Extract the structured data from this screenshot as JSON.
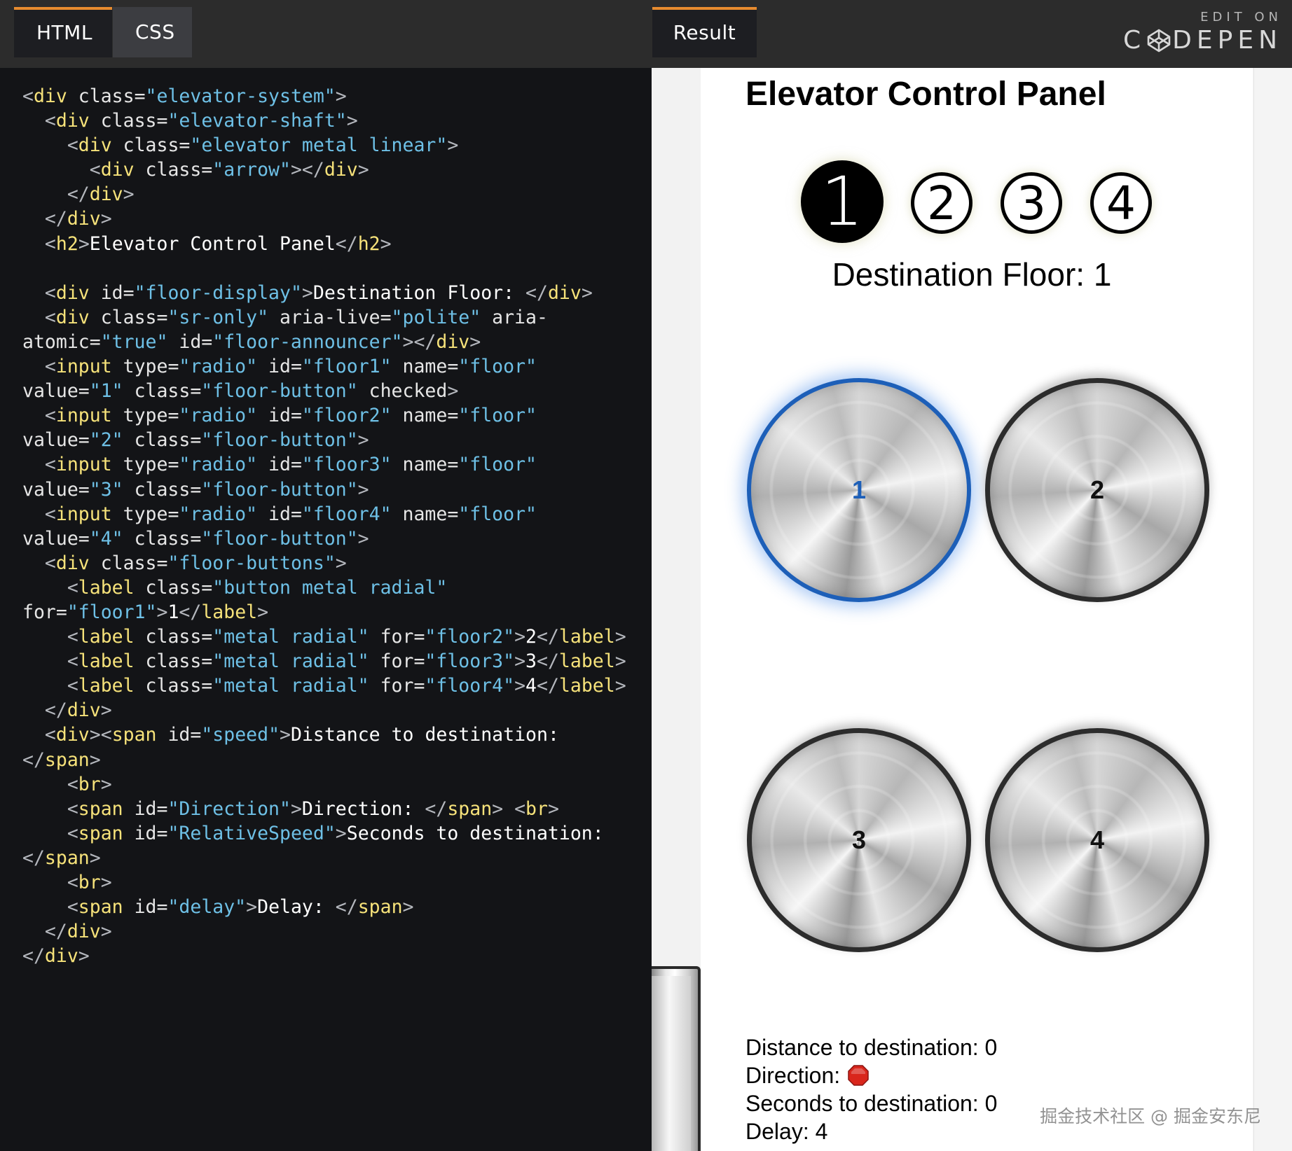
{
  "editor": {
    "tabs": [
      {
        "label": "HTML",
        "active": true
      },
      {
        "label": "CSS",
        "active": false
      }
    ],
    "code_lines": [
      [
        [
          "pn",
          "<"
        ],
        [
          "tg",
          "div"
        ],
        [
          "at",
          " class="
        ],
        [
          "st",
          "\"elevator-system\""
        ],
        [
          "pn",
          ">"
        ]
      ],
      [
        [
          "tx",
          "  "
        ],
        [
          "pn",
          "<"
        ],
        [
          "tg",
          "div"
        ],
        [
          "at",
          " class="
        ],
        [
          "st",
          "\"elevator-shaft\""
        ],
        [
          "pn",
          ">"
        ]
      ],
      [
        [
          "tx",
          "    "
        ],
        [
          "pn",
          "<"
        ],
        [
          "tg",
          "div"
        ],
        [
          "at",
          " class="
        ],
        [
          "st",
          "\"elevator metal linear\""
        ],
        [
          "pn",
          ">"
        ]
      ],
      [
        [
          "tx",
          "      "
        ],
        [
          "pn",
          "<"
        ],
        [
          "tg",
          "div"
        ],
        [
          "at",
          " class="
        ],
        [
          "st",
          "\"arrow\""
        ],
        [
          "pn",
          "></"
        ],
        [
          "tg",
          "div"
        ],
        [
          "pn",
          ">"
        ]
      ],
      [
        [
          "tx",
          "    "
        ],
        [
          "pn",
          "</"
        ],
        [
          "tg",
          "div"
        ],
        [
          "pn",
          ">"
        ]
      ],
      [
        [
          "tx",
          "  "
        ],
        [
          "pn",
          "</"
        ],
        [
          "tg",
          "div"
        ],
        [
          "pn",
          ">"
        ]
      ],
      [
        [
          "tx",
          "  "
        ],
        [
          "pn",
          "<"
        ],
        [
          "tg",
          "h2"
        ],
        [
          "pn",
          ">"
        ],
        [
          "tx",
          "Elevator Control Panel"
        ],
        [
          "pn",
          "</"
        ],
        [
          "tg",
          "h2"
        ],
        [
          "pn",
          ">"
        ]
      ],
      [
        [
          "tx",
          ""
        ]
      ],
      [
        [
          "tx",
          "  "
        ],
        [
          "pn",
          "<"
        ],
        [
          "tg",
          "div"
        ],
        [
          "at",
          " id="
        ],
        [
          "st",
          "\"floor-display\""
        ],
        [
          "pn",
          ">"
        ],
        [
          "tx",
          "Destination Floor: "
        ],
        [
          "pn",
          "</"
        ],
        [
          "tg",
          "div"
        ],
        [
          "pn",
          ">"
        ]
      ],
      [
        [
          "tx",
          "  "
        ],
        [
          "pn",
          "<"
        ],
        [
          "tg",
          "div"
        ],
        [
          "at",
          " class="
        ],
        [
          "st",
          "\"sr-only\""
        ],
        [
          "at",
          " aria-live="
        ],
        [
          "st",
          "\"polite\""
        ],
        [
          "at",
          " aria-"
        ]
      ],
      [
        [
          "at",
          "atomic="
        ],
        [
          "st",
          "\"true\""
        ],
        [
          "at",
          " id="
        ],
        [
          "st",
          "\"floor-announcer\""
        ],
        [
          "pn",
          "></"
        ],
        [
          "tg",
          "div"
        ],
        [
          "pn",
          ">"
        ]
      ],
      [
        [
          "tx",
          "  "
        ],
        [
          "pn",
          "<"
        ],
        [
          "tg",
          "input"
        ],
        [
          "at",
          " type="
        ],
        [
          "st",
          "\"radio\""
        ],
        [
          "at",
          " id="
        ],
        [
          "st",
          "\"floor1\""
        ],
        [
          "at",
          " name="
        ],
        [
          "st",
          "\"floor\""
        ]
      ],
      [
        [
          "at",
          "value="
        ],
        [
          "st",
          "\"1\""
        ],
        [
          "at",
          " class="
        ],
        [
          "st",
          "\"floor-button\""
        ],
        [
          "at",
          " checked"
        ],
        [
          "pn",
          ">"
        ]
      ],
      [
        [
          "tx",
          "  "
        ],
        [
          "pn",
          "<"
        ],
        [
          "tg",
          "input"
        ],
        [
          "at",
          " type="
        ],
        [
          "st",
          "\"radio\""
        ],
        [
          "at",
          " id="
        ],
        [
          "st",
          "\"floor2\""
        ],
        [
          "at",
          " name="
        ],
        [
          "st",
          "\"floor\""
        ]
      ],
      [
        [
          "at",
          "value="
        ],
        [
          "st",
          "\"2\""
        ],
        [
          "at",
          " class="
        ],
        [
          "st",
          "\"floor-button\""
        ],
        [
          "pn",
          ">"
        ]
      ],
      [
        [
          "tx",
          "  "
        ],
        [
          "pn",
          "<"
        ],
        [
          "tg",
          "input"
        ],
        [
          "at",
          " type="
        ],
        [
          "st",
          "\"radio\""
        ],
        [
          "at",
          " id="
        ],
        [
          "st",
          "\"floor3\""
        ],
        [
          "at",
          " name="
        ],
        [
          "st",
          "\"floor\""
        ]
      ],
      [
        [
          "at",
          "value="
        ],
        [
          "st",
          "\"3\""
        ],
        [
          "at",
          " class="
        ],
        [
          "st",
          "\"floor-button\""
        ],
        [
          "pn",
          ">"
        ]
      ],
      [
        [
          "tx",
          "  "
        ],
        [
          "pn",
          "<"
        ],
        [
          "tg",
          "input"
        ],
        [
          "at",
          " type="
        ],
        [
          "st",
          "\"radio\""
        ],
        [
          "at",
          " id="
        ],
        [
          "st",
          "\"floor4\""
        ],
        [
          "at",
          " name="
        ],
        [
          "st",
          "\"floor\""
        ]
      ],
      [
        [
          "at",
          "value="
        ],
        [
          "st",
          "\"4\""
        ],
        [
          "at",
          " class="
        ],
        [
          "st",
          "\"floor-button\""
        ],
        [
          "pn",
          ">"
        ]
      ],
      [
        [
          "tx",
          "  "
        ],
        [
          "pn",
          "<"
        ],
        [
          "tg",
          "div"
        ],
        [
          "at",
          " class="
        ],
        [
          "st",
          "\"floor-buttons\""
        ],
        [
          "pn",
          ">"
        ]
      ],
      [
        [
          "tx",
          "    "
        ],
        [
          "pn",
          "<"
        ],
        [
          "tg",
          "label"
        ],
        [
          "at",
          " class="
        ],
        [
          "st",
          "\"button metal radial\""
        ]
      ],
      [
        [
          "at",
          "for="
        ],
        [
          "st",
          "\"floor1\""
        ],
        [
          "pn",
          ">"
        ],
        [
          "tx",
          "1"
        ],
        [
          "pn",
          "</"
        ],
        [
          "tg",
          "label"
        ],
        [
          "pn",
          ">"
        ]
      ],
      [
        [
          "tx",
          "    "
        ],
        [
          "pn",
          "<"
        ],
        [
          "tg",
          "label"
        ],
        [
          "at",
          " class="
        ],
        [
          "st",
          "\"metal radial\""
        ],
        [
          "at",
          " for="
        ],
        [
          "st",
          "\"floor2\""
        ],
        [
          "pn",
          ">"
        ],
        [
          "tx",
          "2"
        ],
        [
          "pn",
          "</"
        ],
        [
          "tg",
          "label"
        ],
        [
          "pn",
          ">"
        ]
      ],
      [
        [
          "tx",
          "    "
        ],
        [
          "pn",
          "<"
        ],
        [
          "tg",
          "label"
        ],
        [
          "at",
          " class="
        ],
        [
          "st",
          "\"metal radial\""
        ],
        [
          "at",
          " for="
        ],
        [
          "st",
          "\"floor3\""
        ],
        [
          "pn",
          ">"
        ],
        [
          "tx",
          "3"
        ],
        [
          "pn",
          "</"
        ],
        [
          "tg",
          "label"
        ],
        [
          "pn",
          ">"
        ]
      ],
      [
        [
          "tx",
          "    "
        ],
        [
          "pn",
          "<"
        ],
        [
          "tg",
          "label"
        ],
        [
          "at",
          " class="
        ],
        [
          "st",
          "\"metal radial\""
        ],
        [
          "at",
          " for="
        ],
        [
          "st",
          "\"floor4\""
        ],
        [
          "pn",
          ">"
        ],
        [
          "tx",
          "4"
        ],
        [
          "pn",
          "</"
        ],
        [
          "tg",
          "label"
        ],
        [
          "pn",
          ">"
        ]
      ],
      [
        [
          "tx",
          "  "
        ],
        [
          "pn",
          "</"
        ],
        [
          "tg",
          "div"
        ],
        [
          "pn",
          ">"
        ]
      ],
      [
        [
          "tx",
          "  "
        ],
        [
          "pn",
          "<"
        ],
        [
          "tg",
          "div"
        ],
        [
          "pn",
          "><"
        ],
        [
          "tg",
          "span"
        ],
        [
          "at",
          " id="
        ],
        [
          "st",
          "\"speed\""
        ],
        [
          "pn",
          ">"
        ],
        [
          "tx",
          "Distance to destination:"
        ]
      ],
      [
        [
          "pn",
          "</"
        ],
        [
          "tg",
          "span"
        ],
        [
          "pn",
          ">"
        ]
      ],
      [
        [
          "tx",
          "    "
        ],
        [
          "pn",
          "<"
        ],
        [
          "tg",
          "br"
        ],
        [
          "pn",
          ">"
        ]
      ],
      [
        [
          "tx",
          "    "
        ],
        [
          "pn",
          "<"
        ],
        [
          "tg",
          "span"
        ],
        [
          "at",
          " id="
        ],
        [
          "st",
          "\"Direction\""
        ],
        [
          "pn",
          ">"
        ],
        [
          "tx",
          "Direction: "
        ],
        [
          "pn",
          "</"
        ],
        [
          "tg",
          "span"
        ],
        [
          "pn",
          "> <"
        ],
        [
          "tg",
          "br"
        ],
        [
          "pn",
          ">"
        ]
      ],
      [
        [
          "tx",
          "    "
        ],
        [
          "pn",
          "<"
        ],
        [
          "tg",
          "span"
        ],
        [
          "at",
          " id="
        ],
        [
          "st",
          "\"RelativeSpeed\""
        ],
        [
          "pn",
          ">"
        ],
        [
          "tx",
          "Seconds to destination:"
        ]
      ],
      [
        [
          "pn",
          "</"
        ],
        [
          "tg",
          "span"
        ],
        [
          "pn",
          ">"
        ]
      ],
      [
        [
          "tx",
          "    "
        ],
        [
          "pn",
          "<"
        ],
        [
          "tg",
          "br"
        ],
        [
          "pn",
          ">"
        ]
      ],
      [
        [
          "tx",
          "    "
        ],
        [
          "pn",
          "<"
        ],
        [
          "tg",
          "span"
        ],
        [
          "at",
          " id="
        ],
        [
          "st",
          "\"delay\""
        ],
        [
          "pn",
          ">"
        ],
        [
          "tx",
          "Delay: "
        ],
        [
          "pn",
          "</"
        ],
        [
          "tg",
          "span"
        ],
        [
          "pn",
          ">"
        ]
      ],
      [
        [
          "tx",
          "  "
        ],
        [
          "pn",
          "</"
        ],
        [
          "tg",
          "div"
        ],
        [
          "pn",
          ">"
        ]
      ],
      [
        [
          "pn",
          "</"
        ],
        [
          "tg",
          "div"
        ],
        [
          "pn",
          ">"
        ]
      ]
    ]
  },
  "result_tab": {
    "label": "Result"
  },
  "codepen": {
    "edit_on": "EDIT ON",
    "brand_left": "C",
    "brand_right": "DEPEN"
  },
  "result": {
    "title": "Elevator Control Panel",
    "floor_indicators": [
      {
        "label": "1",
        "active": true
      },
      {
        "label": "2",
        "active": false
      },
      {
        "label": "3",
        "active": false
      },
      {
        "label": "4",
        "active": false
      }
    ],
    "floor_display": "Destination Floor: 1",
    "buttons": [
      {
        "label": "1",
        "selected": true
      },
      {
        "label": "2",
        "selected": false
      },
      {
        "label": "3",
        "selected": false
      },
      {
        "label": "4",
        "selected": false
      }
    ],
    "stats": {
      "distance": "Distance to destination: 0",
      "direction": "Direction:",
      "direction_icon": "stop-sign-icon",
      "seconds": "Seconds to destination: 0",
      "delay": "Delay: 4"
    }
  },
  "watermark": "掘金技术社区 @ 掘金安东尼",
  "colors": {
    "tab_accent": "#e78b2f",
    "selected_button": "#1d5fb8",
    "code_tag": "#f6e27a",
    "code_string": "#6ec0e6"
  }
}
